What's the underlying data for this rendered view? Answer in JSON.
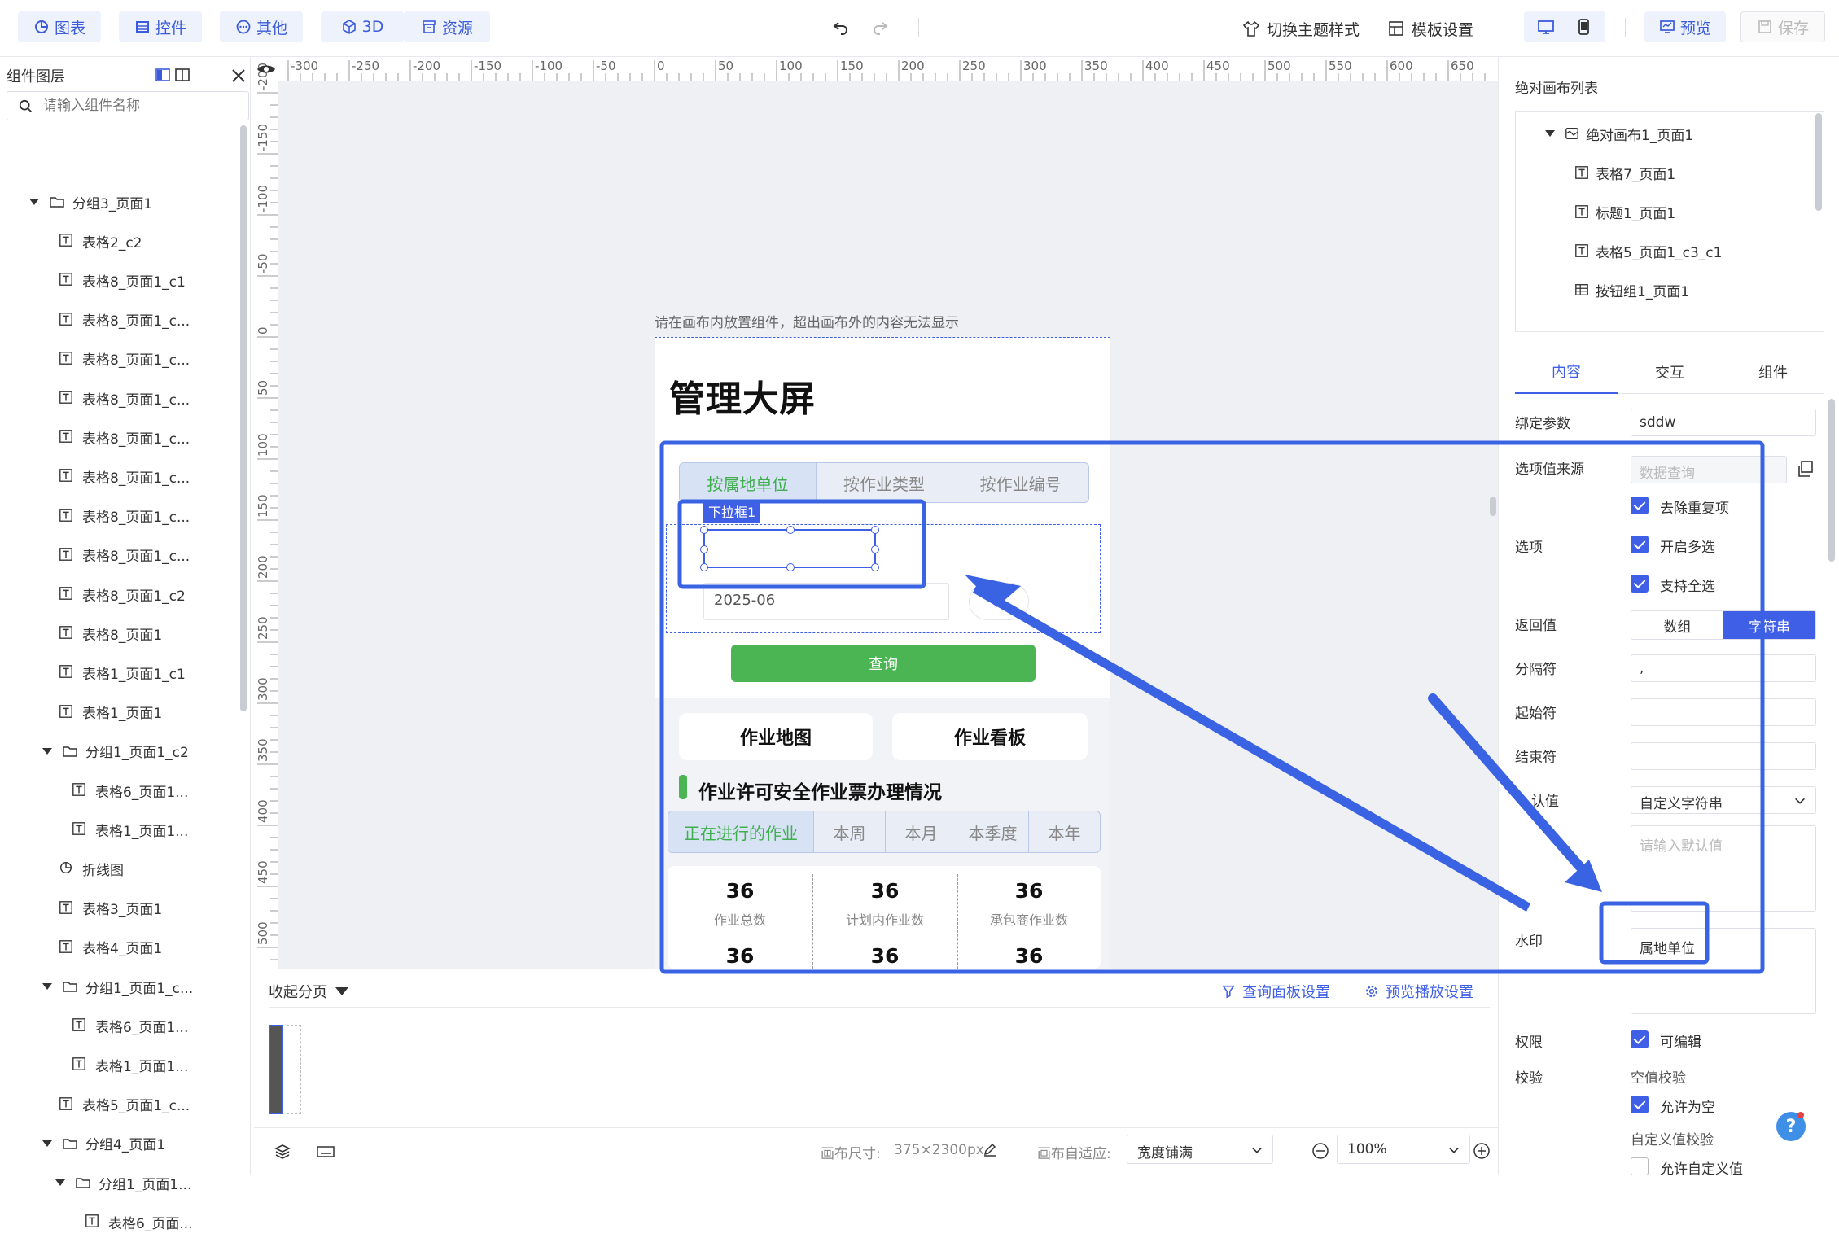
{
  "toolbar": {
    "chart": "图表",
    "control": "控件",
    "other": "其他",
    "three_d": "3D",
    "resource": "资源",
    "switch_theme": "切换主题样式",
    "template_settings": "模板设置",
    "preview": "预览",
    "save": "保存"
  },
  "layers": {
    "title": "组件图层",
    "search_placeholder": "请输入组件名称",
    "items": [
      {
        "label": "分组3_页面1",
        "type": "group"
      },
      {
        "label": "表格2_c2",
        "type": "text"
      },
      {
        "label": "表格8_页面1_c1",
        "type": "text"
      },
      {
        "label": "表格8_页面1_c...",
        "type": "text"
      },
      {
        "label": "表格8_页面1_c...",
        "type": "text"
      },
      {
        "label": "表格8_页面1_c...",
        "type": "text"
      },
      {
        "label": "表格8_页面1_c...",
        "type": "text"
      },
      {
        "label": "表格8_页面1_c...",
        "type": "text"
      },
      {
        "label": "表格8_页面1_c...",
        "type": "text"
      },
      {
        "label": "表格8_页面1_c...",
        "type": "text"
      },
      {
        "label": "表格8_页面1_c2",
        "type": "text"
      },
      {
        "label": "表格8_页面1",
        "type": "text"
      },
      {
        "label": "表格1_页面1_c1",
        "type": "text"
      },
      {
        "label": "表格1_页面1",
        "type": "text"
      },
      {
        "label": "分组1_页面1_c2",
        "type": "group"
      },
      {
        "label": "表格6_页面1...",
        "type": "text"
      },
      {
        "label": "表格1_页面1...",
        "type": "text"
      },
      {
        "label": "折线图",
        "type": "chart"
      },
      {
        "label": "表格3_页面1",
        "type": "text"
      },
      {
        "label": "表格4_页面1",
        "type": "text"
      },
      {
        "label": "分组1_页面1_c...",
        "type": "group"
      },
      {
        "label": "表格6_页面1...",
        "type": "text"
      },
      {
        "label": "表格1_页面1...",
        "type": "text"
      },
      {
        "label": "表格5_页面1_c...",
        "type": "text"
      },
      {
        "label": "分组4_页面1",
        "type": "group"
      },
      {
        "label": "分组1_页面1...",
        "type": "group"
      },
      {
        "label": "表格6_页面...",
        "type": "text"
      }
    ]
  },
  "ruler": {
    "top_ticks": [
      "-300",
      "-250",
      "-200",
      "-150",
      "-100",
      "-50",
      "0",
      "50",
      "100",
      "150",
      "200",
      "250",
      "300",
      "350",
      "400",
      "450",
      "500",
      "550",
      "600",
      "650"
    ],
    "left_ticks": [
      "-200",
      "-150",
      "-100",
      "-50",
      "0",
      "50",
      "100",
      "150",
      "200",
      "250",
      "300",
      "350",
      "400",
      "450",
      "500"
    ]
  },
  "canvas": {
    "hint": "请在画布内放置组件，超出画布外的内容无法显示",
    "screen_title": "管理大屏",
    "tabs": [
      "按属地单位",
      "按作业类型",
      "按作业编号"
    ],
    "dropdown_badge": "下拉框1",
    "date_value": "2025-06",
    "query_button": "查询",
    "card_map": "作业地图",
    "card_board": "作业看板",
    "section_title": "作业许可安全作业票办理情况",
    "period_tabs": [
      "正在进行的作业",
      "本周",
      "本月",
      "本季度",
      "本年"
    ],
    "stats": [
      {
        "value": "36",
        "label": "作业总数"
      },
      {
        "value": "36",
        "label": "计划内作业数"
      },
      {
        "value": "36",
        "label": "承包商作业数"
      }
    ],
    "stats_row2": [
      "36",
      "36",
      "36"
    ]
  },
  "bottom": {
    "collapse_pages": "收起分页",
    "query_panel_settings": "查询面板设置",
    "preview_play_settings": "预览播放设置",
    "canvas_size_label": "画布尺寸:",
    "canvas_size_value": "375×2300px",
    "adapt_label": "画布自适应:",
    "adapt_value": "宽度铺满",
    "zoom": "100%"
  },
  "right": {
    "list_title": "绝对画布列表",
    "list_items": [
      {
        "label": "绝对画布1_页面1",
        "type": "canvas"
      },
      {
        "label": "表格7_页面1",
        "type": "text"
      },
      {
        "label": "标题1_页面1",
        "type": "text"
      },
      {
        "label": "表格5_页面1_c3_c1",
        "type": "text"
      },
      {
        "label": "按钮组1_页面1",
        "type": "buttons"
      }
    ],
    "tabs": [
      "内容",
      "交互",
      "组件"
    ],
    "bind_param_label": "绑定参数",
    "bind_param_value": "sddw",
    "option_source_label": "选项值来源",
    "option_source_value": "数据查询",
    "options_label": "选项",
    "dedupe": "去除重复项",
    "multi": "开启多选",
    "select_all": "支持全选",
    "return_label": "返回值",
    "return_array": "数组",
    "return_string": "字符串",
    "separator_label": "分隔符",
    "separator_value": ",",
    "start_label": "起始符",
    "end_label": "结束符",
    "default_label": "认值",
    "default_type": "自定义字符串",
    "default_placeholder": "请输入默认值",
    "watermark_label": "水印",
    "watermark_value": "属地单位",
    "permission_label": "权限",
    "editable": "可编辑",
    "validation_label": "校验",
    "null_check": "空值校验",
    "allow_empty": "允许为空",
    "custom_check": "自定义值校验",
    "allow_custom": "允许自定义值"
  },
  "colors": {
    "accent": "#3f5fe6",
    "green": "#4cb553",
    "highlight_box": "#3a63e3"
  }
}
